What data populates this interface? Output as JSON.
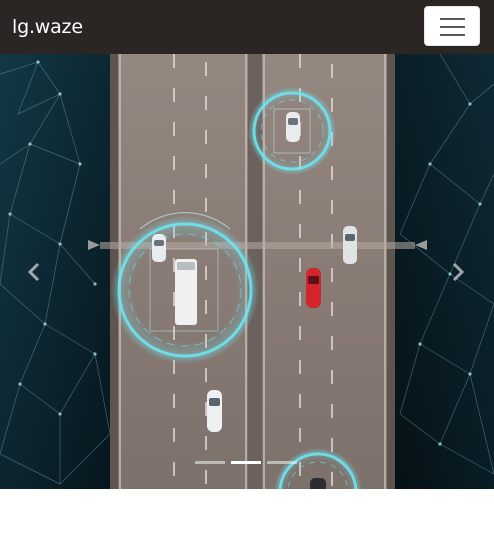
{
  "navbar": {
    "brand": "lg.waze",
    "toggler_icon": "hamburger-menu-icon"
  },
  "carousel": {
    "slide_count": 3,
    "active_index": 1,
    "prev_icon": "chevron-left-icon",
    "next_icon": "chevron-right-icon"
  },
  "colors": {
    "navbar_bg": "#2b2523",
    "road": "#8c7f78",
    "water": "#0b1c24",
    "hud_cyan": "#6fe3ee",
    "car_red": "#d2262c"
  }
}
